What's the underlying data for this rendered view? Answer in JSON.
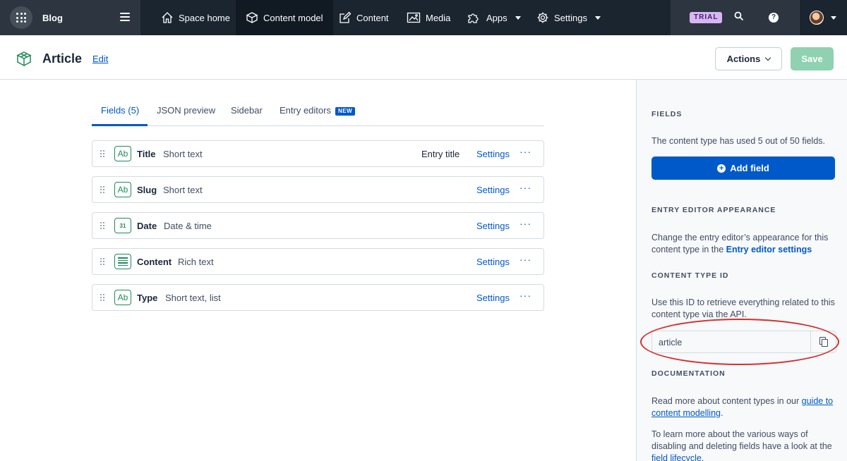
{
  "topnav": {
    "space_name": "Blog",
    "items": [
      {
        "label": "Space home",
        "icon": "home-icon"
      },
      {
        "label": "Content model",
        "icon": "cube-icon"
      },
      {
        "label": "Content",
        "icon": "edit-icon"
      },
      {
        "label": "Media",
        "icon": "image-icon"
      },
      {
        "label": "Apps",
        "icon": "puzzle-icon"
      },
      {
        "label": "Settings",
        "icon": "gear-icon"
      }
    ],
    "trial_badge": "TRIAL"
  },
  "header": {
    "title": "Article",
    "edit_label": "Edit",
    "actions_label": "Actions",
    "save_label": "Save"
  },
  "tabs": [
    {
      "label": "Fields (5)",
      "active": true
    },
    {
      "label": "JSON preview"
    },
    {
      "label": "Sidebar"
    },
    {
      "label": "Entry editors",
      "badge": "NEW"
    }
  ],
  "fields": [
    {
      "name": "Title",
      "type": "Short text",
      "icon": "text-icon",
      "icon_text": "Ab",
      "entry_title": "Entry title",
      "settings": "Settings",
      "more": "···"
    },
    {
      "name": "Slug",
      "type": "Short text",
      "icon": "text-icon",
      "icon_text": "Ab",
      "settings": "Settings",
      "more": "···"
    },
    {
      "name": "Date",
      "type": "Date & time",
      "icon": "calendar-icon",
      "icon_text": "31",
      "settings": "Settings",
      "more": "···"
    },
    {
      "name": "Content",
      "type": "Rich text",
      "icon": "rich-text-icon",
      "settings": "Settings",
      "more": "···"
    },
    {
      "name": "Type",
      "type": "Short text, list",
      "icon": "text-icon",
      "icon_text": "Ab",
      "settings": "Settings",
      "more": "···"
    }
  ],
  "sidebar": {
    "fields_heading": "FIELDS",
    "fields_text": "The content type has used 5 out of 50 fields.",
    "add_field_label": "Add field",
    "appearance_heading": "ENTRY EDITOR APPEARANCE",
    "appearance_text": "Change the entry editor’s appearance for this content type in the ",
    "appearance_link": "Entry editor settings",
    "id_heading": "CONTENT TYPE ID",
    "id_text": "Use this ID to retrieve everything related to this content type via the API.",
    "id_value": "article",
    "docs_heading": "DOCUMENTATION",
    "docs_text1": "Read more about content types in our ",
    "docs_link1": "guide to content modelling",
    "docs_text1_end": ".",
    "docs_text2": "To learn more about the various ways of disabling and deleting fields have a look at the ",
    "docs_link2": "field lifecycle",
    "docs_text2_end": "."
  },
  "colors": {
    "nav_bg": "#2d3640",
    "primary": "#0059c8",
    "save_disabled": "#8fd1b1",
    "field_icon": "#1f8a5b",
    "annotation": "#d62f2f"
  }
}
